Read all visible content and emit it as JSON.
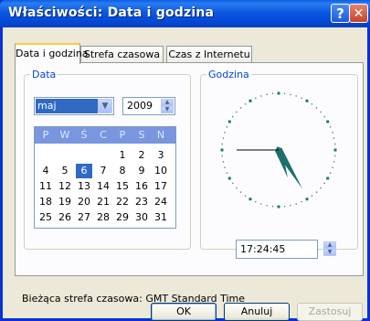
{
  "window": {
    "title": "Właściwości: Data i godzina",
    "help_label": "?",
    "close_label": "✕"
  },
  "tabs": [
    {
      "label": "Data i godzina",
      "active": true
    },
    {
      "label": "Strefa czasowa",
      "active": false
    },
    {
      "label": "Czas z Internetu",
      "active": false
    }
  ],
  "date": {
    "legend": "Data",
    "month": "maj",
    "year": "2009",
    "weekdays": [
      "P",
      "W",
      "Ś",
      "C",
      "P",
      "S",
      "N"
    ],
    "weeks": [
      [
        "",
        "",
        "",
        "",
        "1",
        "2",
        "3"
      ],
      [
        "4",
        "5",
        "6",
        "7",
        "8",
        "9",
        "10"
      ],
      [
        "11",
        "12",
        "13",
        "14",
        "15",
        "16",
        "17"
      ],
      [
        "18",
        "19",
        "20",
        "21",
        "22",
        "23",
        "24"
      ],
      [
        "25",
        "26",
        "27",
        "28",
        "29",
        "30",
        "31"
      ]
    ],
    "selected_day": "6"
  },
  "time": {
    "legend": "Godzina",
    "value": "17:24:45"
  },
  "status": "Bieżąca strefa czasowa: GMT Standard Time",
  "buttons": {
    "ok": "OK",
    "cancel": "Anuluj",
    "apply": "Zastosuj"
  },
  "colors": {
    "title_bar": "#0b58e0",
    "selected_day": "#316ac5",
    "calendar_header": "#7a96df",
    "clock_hands": "#1e6e6e"
  }
}
